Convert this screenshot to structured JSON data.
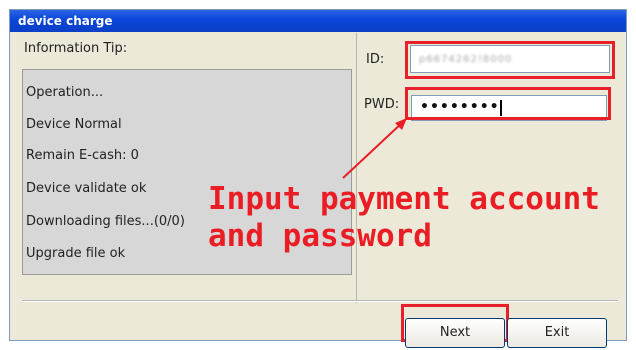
{
  "window": {
    "title": "device charge"
  },
  "info": {
    "label": "Information Tip:",
    "lines": [
      "Operation...",
      "Device Normal",
      "Remain E-cash:  0",
      "Device validate ok",
      "Downloading files...(0/0)",
      "Upgrade file ok"
    ]
  },
  "form": {
    "id_label": "ID:",
    "id_value": "p6674262!8000",
    "pwd_label": "PWD:",
    "pwd_value": "••••••••"
  },
  "annotation": {
    "text": "Input payment account\nand password"
  },
  "buttons": {
    "next": "Next",
    "exit": "Exit"
  },
  "colors": {
    "annotation": "#ea1c24",
    "titlebar": "#0a46d8"
  }
}
